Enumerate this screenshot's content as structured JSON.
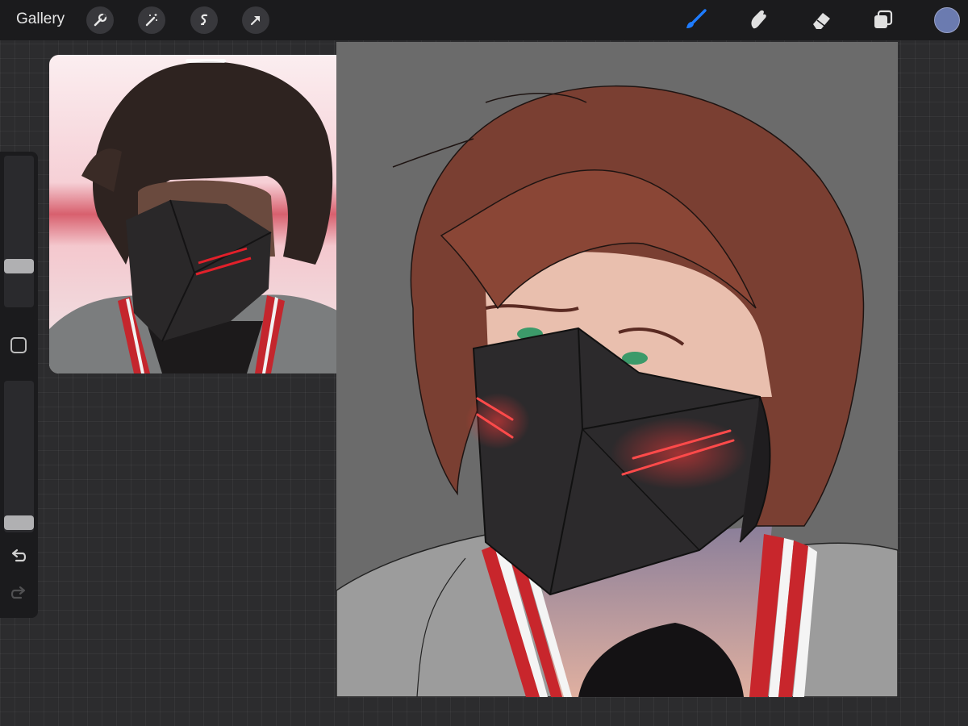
{
  "toolbar": {
    "gallery_label": "Gallery",
    "left_tools": [
      "wrench-icon",
      "magic-wand-icon",
      "selection-icon",
      "transform-arrow-icon"
    ],
    "right_tools": [
      "brush-icon",
      "smudge-icon",
      "eraser-icon",
      "layers-icon"
    ],
    "active_tool": "brush-icon",
    "active_tool_color": "#1e7cff",
    "current_color": "#6b7bb0"
  },
  "sidebar": {
    "brush_size_level": 0.25,
    "opacity_level": 0.02,
    "icons": [
      "modifier-square-icon",
      "undo-icon",
      "redo-icon"
    ]
  },
  "colors": {
    "canvas_background": "#6b6b6b",
    "hair": "#7a3f32",
    "mask": "#2c2a2c",
    "mask_glow": "#e8202a",
    "collar_red": "#c8262c",
    "eyes": "#3c9a6a"
  }
}
